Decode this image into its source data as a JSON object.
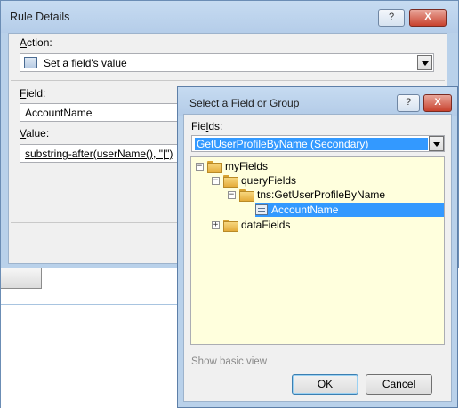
{
  "rule_dialog": {
    "title": "Rule Details",
    "help_button": "?",
    "close_button": "X",
    "action_label_accel": "A",
    "action_label_rest": "ction:",
    "action_value": "Set a field's value",
    "field_label_accel": "F",
    "field_label_rest": "ield:",
    "field_value": "AccountName",
    "value_label_accel": "V",
    "value_label_rest": "alue:",
    "value_value": "substring-after(userName(), \"|\")"
  },
  "select_dialog": {
    "title": "Select a Field or Group",
    "help_button": "?",
    "close_button": "X",
    "fields_label_pre": "Fie",
    "fields_label_accel": "l",
    "fields_label_post": "ds:",
    "data_source": "GetUserProfileByName (Secondary)",
    "tree": [
      {
        "label": "myFields",
        "expander": "−"
      },
      {
        "label": "queryFields",
        "expander": "−"
      },
      {
        "label": "tns:GetUserProfileByName",
        "expander": "−"
      },
      {
        "label": "AccountName",
        "expander": ""
      },
      {
        "label": "dataFields",
        "expander": "+"
      }
    ],
    "show_basic_view": "Show basic view",
    "ok_label": "OK",
    "cancel_label": "Cancel"
  }
}
